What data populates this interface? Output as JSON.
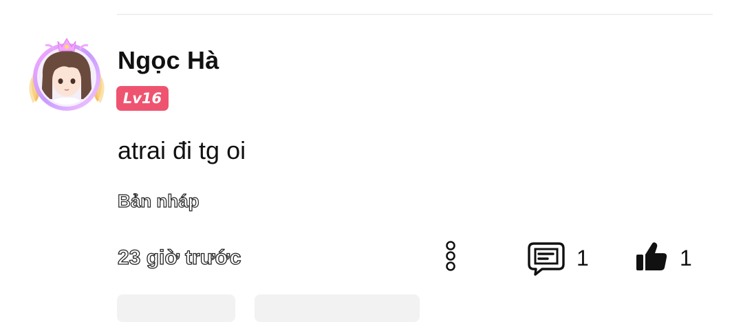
{
  "comment": {
    "author": "Ngọc Hà",
    "level": "Lv16",
    "text": "atrai đi tg oi",
    "status": "Bản nháp",
    "time": "23 giờ trước",
    "reply_count": "1",
    "like_count": "1"
  },
  "icons": {
    "more": "more-vertical-icon",
    "reply": "comment-icon",
    "like": "thumbs-up-icon"
  },
  "colors": {
    "level_badge": "#ee5470",
    "text": "#111111",
    "divider": "#f0f0f0"
  }
}
